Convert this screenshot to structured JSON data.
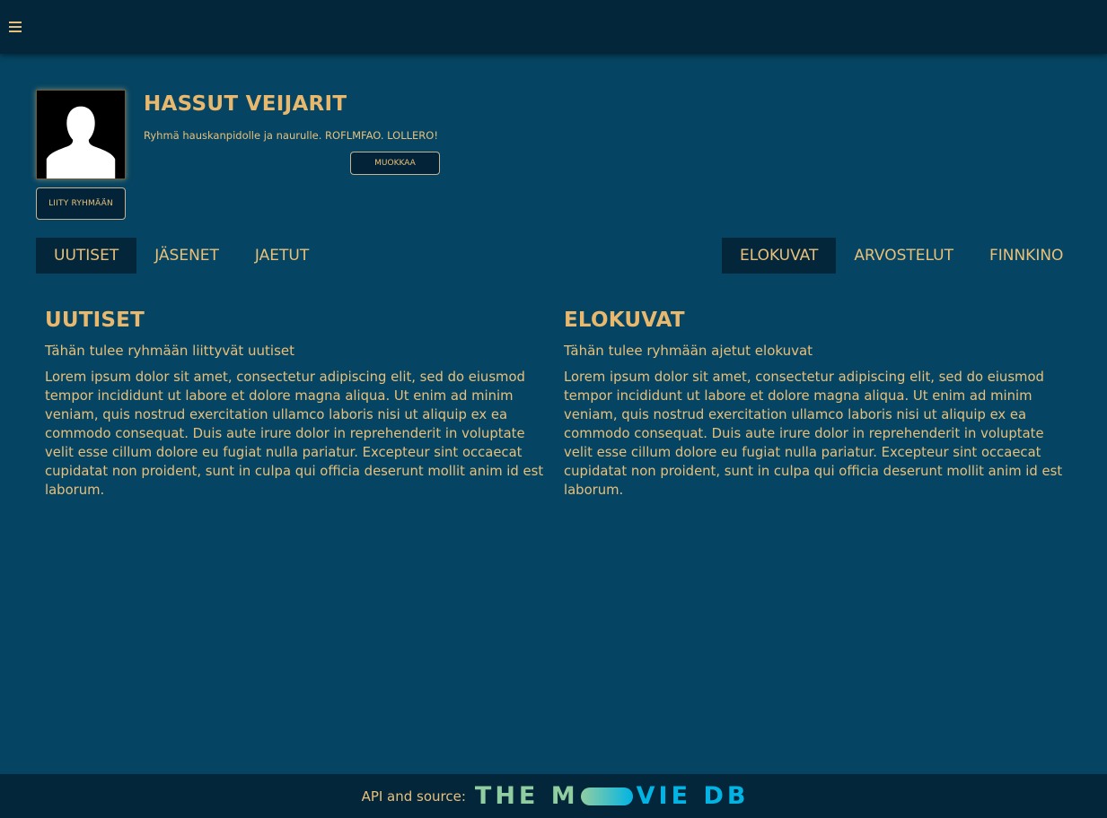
{
  "topbar": {
    "menu_icon": "hamburger-menu-icon"
  },
  "group": {
    "title": "HASSUT VEIJARIT",
    "description": "Ryhmä hauskanpidolle ja naurulle. ROFLMFAO. LOLLERO!",
    "edit_label": "MUOKKAA",
    "join_label": "LIITY RYHMÄÄN",
    "avatar_icon": "user-silhouette-icon"
  },
  "tabs_left": [
    {
      "label": "UUTISET",
      "active": true
    },
    {
      "label": "JÄSENET",
      "active": false
    },
    {
      "label": "JAETUT",
      "active": false
    }
  ],
  "tabs_right": [
    {
      "label": "ELOKUVAT",
      "active": true
    },
    {
      "label": "ARVOSTELUT",
      "active": false
    },
    {
      "label": "FINNKINO",
      "active": false
    }
  ],
  "news": {
    "heading": "UUTISET",
    "subtitle": "Tähän tulee ryhmään liittyvät uutiset",
    "body": "Lorem ipsum dolor sit amet, consectetur adipiscing elit, sed do eiusmod tempor incididunt ut labore et dolore magna aliqua. Ut enim ad minim veniam, quis nostrud exercitation ullamco laboris nisi ut aliquip ex ea commodo consequat. Duis aute irure dolor in reprehenderit in voluptate velit esse cillum dolore eu fugiat nulla pariatur. Excepteur sint occaecat cupidatat non proident, sunt in culpa qui officia deserunt mollit anim id est laborum."
  },
  "movies": {
    "heading": "ELOKUVAT",
    "subtitle": "Tähän tulee ryhmään ajetut elokuvat",
    "body": "Lorem ipsum dolor sit amet, consectetur adipiscing elit, sed do eiusmod tempor incididunt ut labore et dolore magna aliqua. Ut enim ad minim veniam, quis nostrud exercitation ullamco laboris nisi ut aliquip ex ea commodo consequat. Duis aute irure dolor in reprehenderit in voluptate velit esse cillum dolore eu fugiat nulla pariatur. Excepteur sint occaecat cupidatat non proident, sunt in culpa qui officia deserunt mollit anim id est laborum."
  },
  "footer": {
    "label": "API and source:",
    "logo_text_start": "THE M",
    "logo_text_end": "VIE DB"
  },
  "colors": {
    "background": "#054462",
    "bar": "#03263b",
    "accent_text": "#e8c07a",
    "tmdb_green": "#90cea1",
    "tmdb_blue": "#01b4e4"
  }
}
